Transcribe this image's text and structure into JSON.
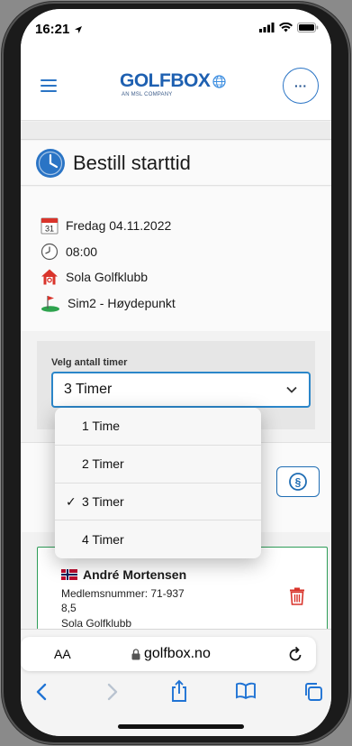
{
  "status": {
    "time": "16:21"
  },
  "header": {
    "logo": "GOLFBOX",
    "logo_sub": "AN MSL COMPANY",
    "more_label": "···"
  },
  "page": {
    "title": "Bestill starttid"
  },
  "booking": {
    "date": "Fredag 04.11.2022",
    "calendar_day": "31",
    "time": "08:00",
    "club": "Sola Golfklubb",
    "course": "Sim2 - Høydepunkt"
  },
  "hours_select": {
    "label": "Velg antall timer",
    "selected": "3 Timer",
    "options": [
      "1 Time",
      "2 Timer",
      "3 Timer",
      "4 Timer"
    ],
    "checked_index": 2
  },
  "player": {
    "name": "André Mortensen",
    "member_number": "Medlemsnummer: 71-937",
    "handicap": "8,5",
    "club": "Sola Golfklubb"
  },
  "safari": {
    "aa_label": "AA",
    "url": "golfbox.no"
  },
  "colors": {
    "accent": "#2a74c5",
    "card_border": "#2e9d58",
    "trash": "#d9342b"
  }
}
